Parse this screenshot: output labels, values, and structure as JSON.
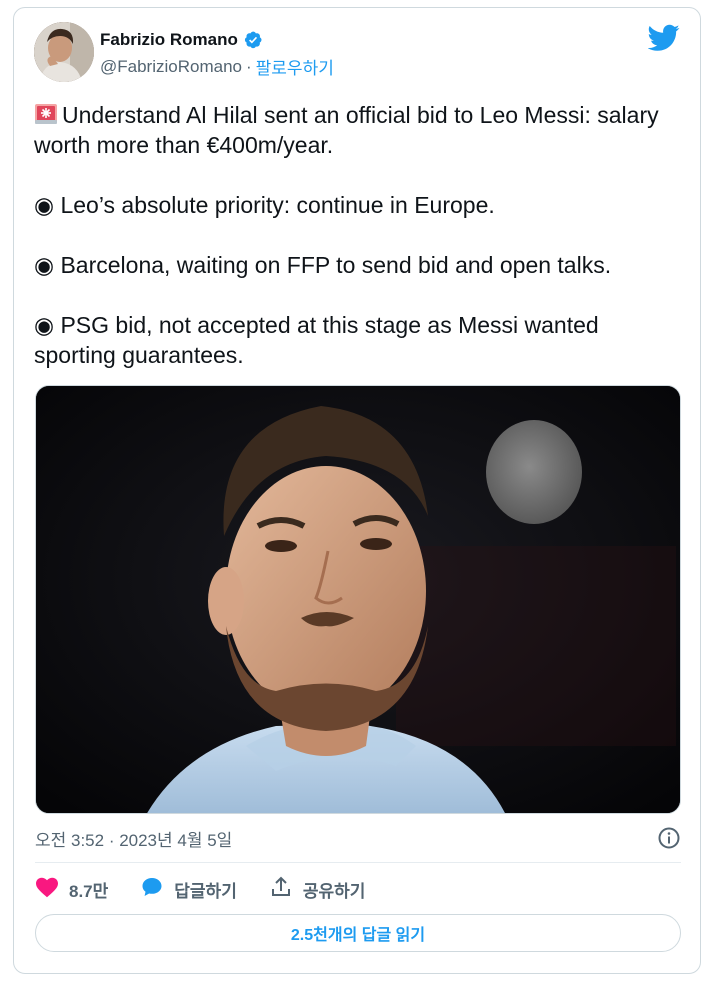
{
  "author": {
    "display_name": "Fabrizio Romano",
    "handle": "@FabrizioRomano",
    "separator": "·",
    "follow_label": "팔로우하기"
  },
  "icons": {
    "verified": "verified-badge-icon",
    "brand": "twitter-bird-icon",
    "siren": "rotating-light-icon",
    "info": "info-icon",
    "like": "heart-icon",
    "reply": "speech-bubble-icon",
    "share": "share-upload-icon"
  },
  "colors": {
    "accent": "#1d9bf0",
    "like": "#f91880",
    "muted": "#536471",
    "text": "#0f1419"
  },
  "tweet": {
    "lines": [
      "Understand Al Hilal sent an official bid to Leo Messi: salary worth more than €400m/year.",
      "◉ Leo’s absolute priority: continue in Europe.",
      "◉ Barcelona, waiting on FFP to send bid and open talks.",
      "◉ PSG bid, not accepted at this stage as Messi wanted sporting guarantees."
    ],
    "timestamp": "오전 3:52 · 2023년 4월 5일"
  },
  "actions": {
    "likes_count": "8.7만",
    "reply_label": "답글하기",
    "share_label": "공유하기"
  },
  "read_replies_label": "2.5천개의 답글 읽기"
}
